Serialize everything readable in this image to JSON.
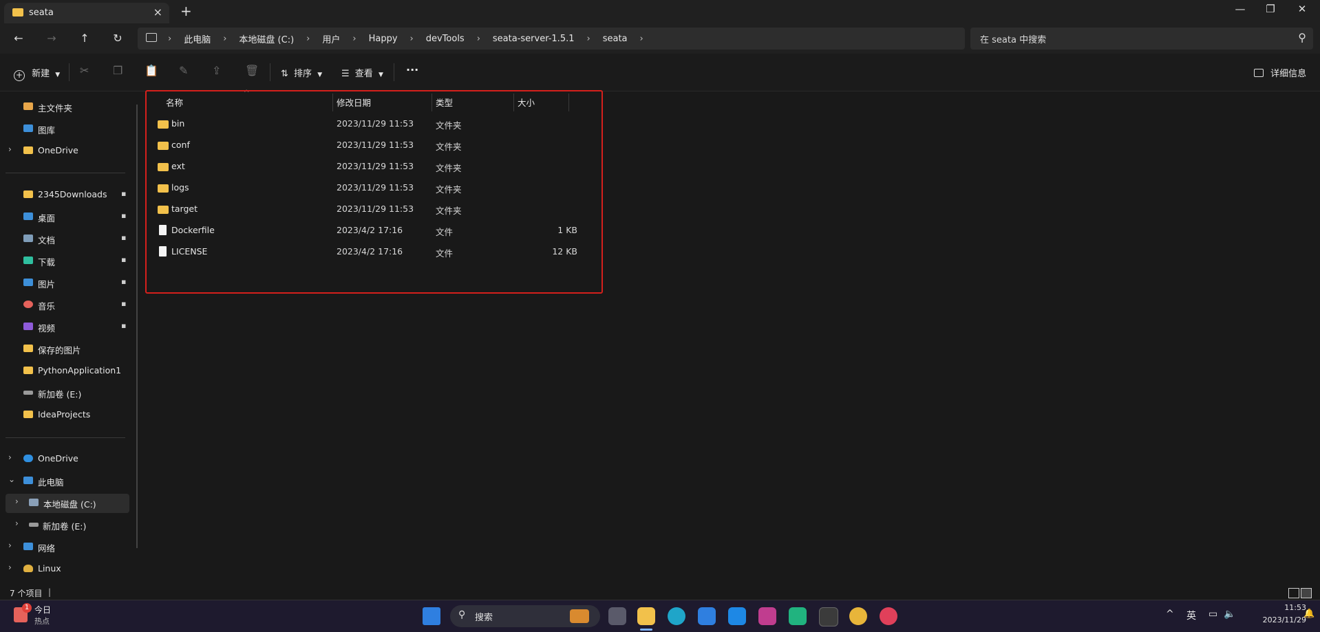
{
  "window": {
    "tab_title": "seata",
    "tab_close": "×",
    "tab_add": "+",
    "minimize": "—",
    "maximize": "❐",
    "close": "✕"
  },
  "nav": {
    "back": "←",
    "forward": "→",
    "up": "↑",
    "refresh": "↻",
    "breadcrumbs": [
      "此电脑",
      "本地磁盘 (C:)",
      "用户",
      "Happy",
      "devTools",
      "seata-server-1.5.1",
      "seata"
    ],
    "crumb_sep": "›",
    "search_placeholder": "在 seata 中搜索"
  },
  "commands": {
    "new_label": "新建",
    "sort_label": "排序",
    "view_label": "查看",
    "more_label": "···",
    "details_label": "详细信息"
  },
  "sidebar": {
    "items": [
      {
        "label": "主文件夹",
        "color": "#e8a64a"
      },
      {
        "label": "图库",
        "color": "#3d8fd9"
      },
      {
        "label": "OneDrive",
        "color": "#f2c14b"
      },
      {
        "label": "2345Downloads",
        "color": "#f2c14b"
      },
      {
        "label": "桌面",
        "color": "#3d8fd9"
      },
      {
        "label": "文档",
        "color": "#7f9db9"
      },
      {
        "label": "下载",
        "color": "#2fbf9f"
      },
      {
        "label": "图片",
        "color": "#3d8fd9"
      },
      {
        "label": "音乐",
        "color": "#e5625b"
      },
      {
        "label": "视频",
        "color": "#8e5bd9"
      },
      {
        "label": "保存的图片",
        "color": "#f2c14b"
      },
      {
        "label": "PythonApplication1",
        "color": "#f2c14b"
      },
      {
        "label": "新加卷 (E:)",
        "color": "#9a9a9a"
      },
      {
        "label": "IdeaProjects",
        "color": "#f2c14b"
      },
      {
        "label": "OneDrive",
        "color": "#2f8fe0"
      },
      {
        "label": "此电脑",
        "color": "#3d8fd9"
      },
      {
        "label": "本地磁盘 (C:)",
        "color": "#8aa0b8"
      },
      {
        "label": "新加卷 (E:)",
        "color": "#9a9a9a"
      },
      {
        "label": "网络",
        "color": "#3d8fd9"
      },
      {
        "label": "Linux",
        "color": "#e0b040"
      }
    ],
    "pin": "📌",
    "chev_right": "›",
    "chev_down": "⌄"
  },
  "table": {
    "headers": {
      "name": "名称",
      "date": "修改日期",
      "type": "类型",
      "size": "大小"
    },
    "sort_arrow": "^",
    "rows": [
      {
        "name": "bin",
        "date": "2023/11/29 11:53",
        "type": "文件夹",
        "size": "",
        "kind": "folder"
      },
      {
        "name": "conf",
        "date": "2023/11/29 11:53",
        "type": "文件夹",
        "size": "",
        "kind": "folder"
      },
      {
        "name": "ext",
        "date": "2023/11/29 11:53",
        "type": "文件夹",
        "size": "",
        "kind": "folder"
      },
      {
        "name": "logs",
        "date": "2023/11/29 11:53",
        "type": "文件夹",
        "size": "",
        "kind": "folder"
      },
      {
        "name": "target",
        "date": "2023/11/29 11:53",
        "type": "文件夹",
        "size": "",
        "kind": "folder"
      },
      {
        "name": "Dockerfile",
        "date": "2023/4/2 17:16",
        "type": "文件",
        "size": "1 KB",
        "kind": "file"
      },
      {
        "name": "LICENSE",
        "date": "2023/4/2 17:16",
        "type": "文件",
        "size": "12 KB",
        "kind": "file"
      }
    ]
  },
  "status": {
    "item_count": "7 个项目"
  },
  "taskbar": {
    "widget_title": "今日",
    "widget_sub": "热点",
    "widget_badge": "1",
    "search_label": "搜索",
    "ime": "英",
    "time": "11:53",
    "date": "2023/11/29",
    "tray_up": "^"
  }
}
